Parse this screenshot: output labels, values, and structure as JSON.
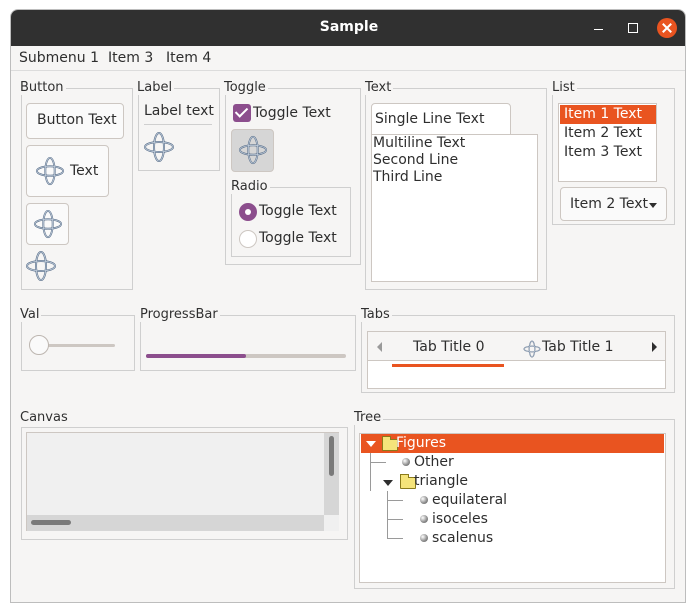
{
  "window": {
    "title": "Sample"
  },
  "menubar": {
    "items": [
      "Submenu 1",
      "Item 3",
      "Item 4"
    ]
  },
  "groups": {
    "button": "Button",
    "label": "Label",
    "toggle": "Toggle",
    "radio": "Radio",
    "text": "Text",
    "list": "List",
    "val": "Val",
    "progressbar": "ProgressBar",
    "tabs": "Tabs",
    "canvas": "Canvas",
    "tree": "Tree"
  },
  "button": {
    "text_button": "Button Text",
    "icon_text_button": "Text"
  },
  "label": {
    "text": "Label text"
  },
  "toggle": {
    "check_label": "Toggle Text",
    "checked": true
  },
  "radio": {
    "option1": "Toggle Text",
    "option2": "Toggle Text",
    "selected": 1
  },
  "text": {
    "single_line": "Single Line Text",
    "multiline": [
      "Multiline Text",
      "Second Line",
      "Third Line"
    ]
  },
  "list": {
    "items": [
      "Item 1 Text",
      "Item 2 Text",
      "Item 3 Text"
    ],
    "selected": 0,
    "dropdown_value": "Item 2 Text"
  },
  "val": {
    "value": 0
  },
  "progressbar": {
    "fraction": 0.5
  },
  "tabs": {
    "titles": [
      "Tab Title 0",
      "Tab Title 1"
    ],
    "active": 0
  },
  "tree": {
    "root": "Figures",
    "child1": "Other",
    "child2": "triangle",
    "leaves": [
      "equilateral",
      "isoceles",
      "scalenus"
    ]
  },
  "colors": {
    "accent": "#e95420",
    "check": "#8c4e8d",
    "titlebar": "#303030"
  },
  "icons": {
    "gimbal": "gimbal-icon",
    "folder": "folder-icon",
    "bullet": "bullet-icon"
  }
}
